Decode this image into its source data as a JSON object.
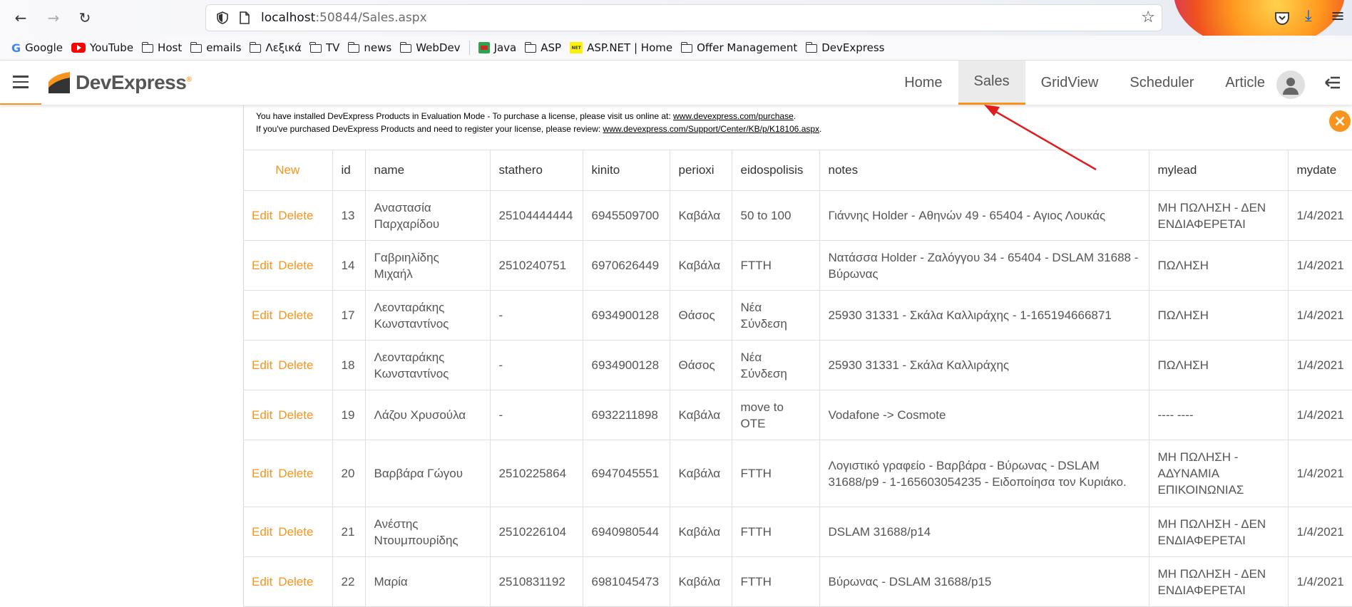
{
  "browser": {
    "url_host": "localhost",
    "url_rest": ":50844/Sales.aspx",
    "bookmarks": [
      {
        "label": "Google",
        "icon": "google-icon"
      },
      {
        "label": "YouTube",
        "icon": "youtube-icon"
      },
      {
        "label": "Host",
        "icon": "folder-icon"
      },
      {
        "label": "emails",
        "icon": "folder-icon"
      },
      {
        "label": "Λεξικά",
        "icon": "folder-icon"
      },
      {
        "label": "TV",
        "icon": "folder-icon"
      },
      {
        "label": "news",
        "icon": "folder-icon"
      },
      {
        "label": "WebDev",
        "icon": "folder-icon"
      },
      {
        "label": "Java",
        "icon": "java-icon"
      },
      {
        "label": "ASP",
        "icon": "folder-icon"
      },
      {
        "label": "ASP.NET | Home",
        "icon": "aspnet-icon"
      },
      {
        "label": "Offer Management",
        "icon": "folder-icon"
      },
      {
        "label": "DevExpress",
        "icon": "folder-icon"
      }
    ]
  },
  "header": {
    "logo_text": "DevExpress",
    "logo_mark": "®",
    "accent": "#f7941d",
    "nav": [
      {
        "label": "Home",
        "active": false
      },
      {
        "label": "Sales",
        "active": true
      },
      {
        "label": "GridView",
        "active": false
      },
      {
        "label": "Scheduler",
        "active": false
      },
      {
        "label": "Article",
        "active": false
      }
    ]
  },
  "notice": {
    "line1_text": "You have installed DevExpress Products in Evaluation Mode - To purchase a license, please visit us online at: ",
    "line1_link": "www.devexpress.com/purchase",
    "line1_end": ".",
    "line2_text": "If you've purchased DevExpress Products and need to register your license, please review: ",
    "line2_link": "www.devexpress.com/Support/Center/KB/p/K18106.aspx",
    "line2_end": "."
  },
  "grid": {
    "new_label": "New",
    "edit_label": "Edit",
    "delete_label": "Delete",
    "columns": [
      "id",
      "name",
      "stathero",
      "kinito",
      "perioxi",
      "eidospolisis",
      "notes",
      "mylead",
      "mydate"
    ],
    "rows": [
      {
        "id": "13",
        "name": "Αναστασία Παρχαρίδου",
        "stathero": "25104444444",
        "kinito": "6945509700",
        "perioxi": "Καβάλα",
        "eidospolisis": "50 to 100",
        "notes": "Γιάννης Holder - Αθηνών 49 - 65404 - Αγιος Λουκάς",
        "mylead": "ΜΗ ΠΩΛΗΣΗ - ΔΕΝ ΕΝΔΙΑΦΕΡΕΤΑΙ",
        "mydate": "1/4/2021"
      },
      {
        "id": "14",
        "name": "Γαβριηλίδης Μιχαήλ",
        "stathero": "2510240751",
        "kinito": "6970626449",
        "perioxi": "Καβάλα",
        "eidospolisis": "FTTH",
        "notes": "Νατάσσα Holder - Ζαλόγγου 34 - 65404 - DSLAM 31688 - Βύρωνας",
        "mylead": "ΠΩΛΗΣΗ",
        "mydate": "1/4/2021"
      },
      {
        "id": "17",
        "name": "Λεονταράκης Κωνσταντίνος",
        "stathero": "-",
        "kinito": "6934900128",
        "perioxi": "Θάσος",
        "eidospolisis": "Νέα Σύνδεση",
        "notes": "25930 31331 - Σκάλα Καλλιράχης - 1-165194666871",
        "mylead": "ΠΩΛΗΣΗ",
        "mydate": "1/4/2021"
      },
      {
        "id": "18",
        "name": "Λεονταράκης Κωνσταντίνος",
        "stathero": "-",
        "kinito": "6934900128",
        "perioxi": "Θάσος",
        "eidospolisis": "Νέα Σύνδεση",
        "notes": "25930 31331 - Σκάλα Καλλιράχης",
        "mylead": "ΠΩΛΗΣΗ",
        "mydate": "1/4/2021"
      },
      {
        "id": "19",
        "name": "Λάζου Χρυσούλα",
        "stathero": "-",
        "kinito": "6932211898",
        "perioxi": "Καβάλα",
        "eidospolisis": "move to OTE",
        "notes": "Vodafone -> Cosmote",
        "mylead": "---- ----",
        "mydate": "1/4/2021"
      },
      {
        "id": "20",
        "name": "Βαρβάρα Γώγου",
        "stathero": "2510225864",
        "kinito": "6947045551",
        "perioxi": "Καβάλα",
        "eidospolisis": "FTTH",
        "notes": "Λογιστικό γραφείο - Βαρβάρα - Βύρωνας - DSLAM 31688/p9 - 1-165603054235 - Ειδοποίησα τον Κυριάκο.",
        "mylead": "ΜΗ ΠΩΛΗΣΗ - ΑΔΥΝΑΜΙΑ ΕΠΙΚΟΙΝΩΝΙΑΣ",
        "mydate": "1/4/2021"
      },
      {
        "id": "21",
        "name": "Ανέστης Ντουμπουρίδης",
        "stathero": "2510226104",
        "kinito": "6940980544",
        "perioxi": "Καβάλα",
        "eidospolisis": "FTTH",
        "notes": "DSLAM 31688/p14",
        "mylead": "ΜΗ ΠΩΛΗΣΗ - ΔΕΝ ΕΝΔΙΑΦΕΡΕΤΑΙ",
        "mydate": "1/4/2021"
      },
      {
        "id": "22",
        "name": "Μαρία",
        "stathero": "2510831192",
        "kinito": "6981045473",
        "perioxi": "Καβάλα",
        "eidospolisis": "FTTH",
        "notes": "Βύρωνας - DSLAM 31688/p15",
        "mylead": "ΜΗ ΠΩΛΗΣΗ - ΔΕΝ ΕΝΔΙΑΦΕΡΕΤΑΙ",
        "mydate": "1/4/2021"
      }
    ]
  }
}
